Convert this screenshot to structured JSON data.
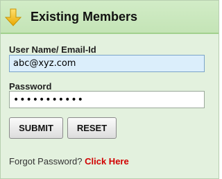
{
  "header": {
    "title": "Existing Members",
    "icon": "down-arrow-icon",
    "icon_color": "#f2c20d",
    "background": "#c8e7bb"
  },
  "form": {
    "username_label": "User Name/ Email-Id",
    "username_value": "abc@xyz.com",
    "password_label": "Password",
    "password_value": "•••••••••••",
    "submit_label": "SUBMIT",
    "reset_label": "RESET"
  },
  "footer": {
    "forgot_text": "Forgot Password?",
    "click_here_label": "Click Here",
    "link_color": "#d10000"
  }
}
